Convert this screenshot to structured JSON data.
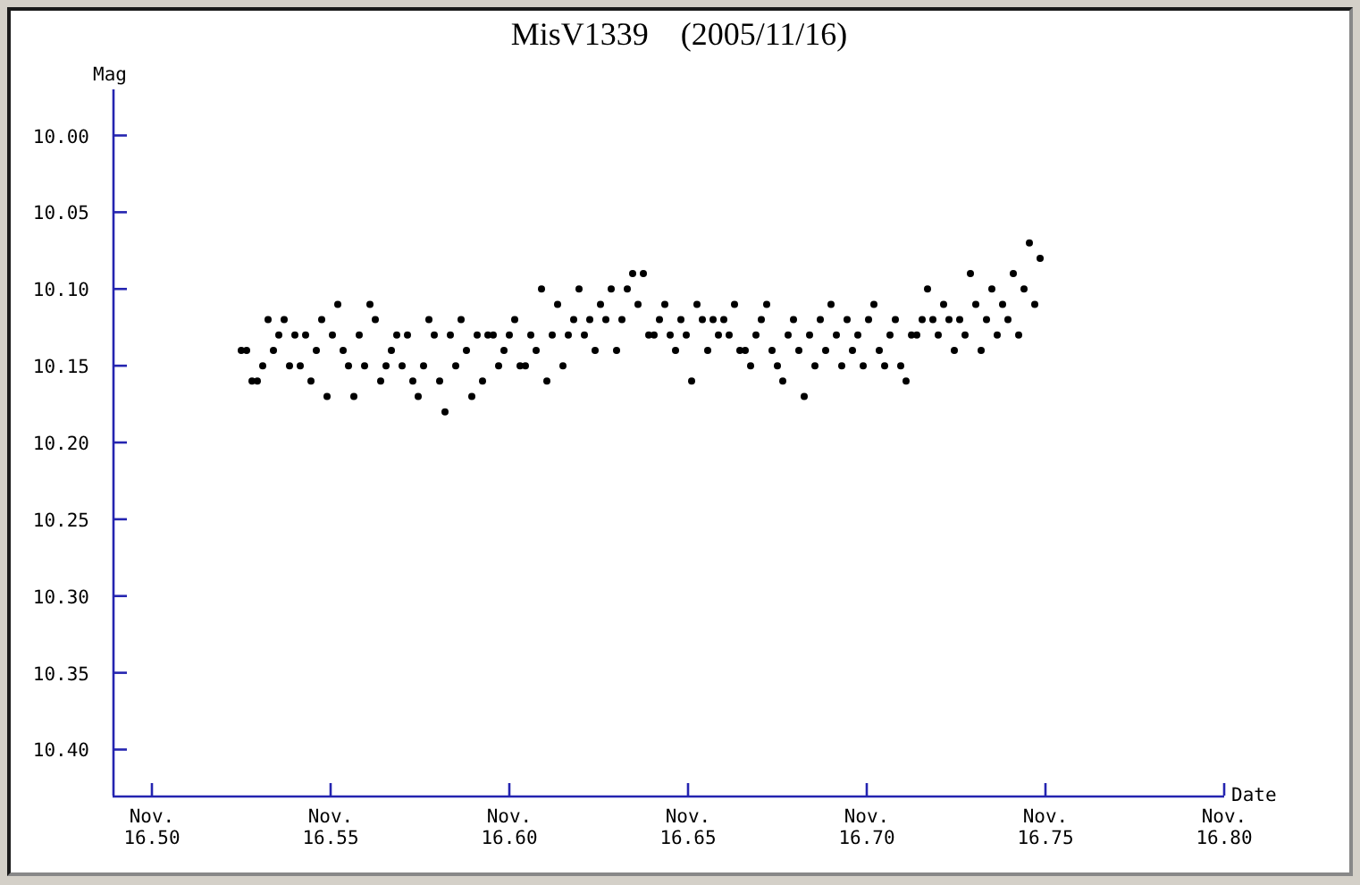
{
  "chart": {
    "chart_data": {
      "type": "scatter",
      "title": "MisV1339　(2005/11/16)",
      "xlabel": "Date",
      "ylabel": "Mag",
      "xlim": [
        16.489,
        16.8
      ],
      "ylim": [
        10.43,
        9.97
      ],
      "xticks": [
        {
          "value": 16.5,
          "label": "16.50"
        },
        {
          "value": 16.55,
          "label": "16.55"
        },
        {
          "value": 16.6,
          "label": "16.60"
        },
        {
          "value": 16.65,
          "label": "16.65"
        },
        {
          "value": 16.7,
          "label": "16.70"
        },
        {
          "value": 16.75,
          "label": "16.75"
        },
        {
          "value": 16.8,
          "label": "16.80"
        }
      ],
      "yticks": [
        {
          "value": 10.0,
          "label": "10.00"
        },
        {
          "value": 10.05,
          "label": "10.05"
        },
        {
          "value": 10.1,
          "label": "10.10"
        },
        {
          "value": 10.15,
          "label": "10.15"
        },
        {
          "value": 10.2,
          "label": "10.20"
        },
        {
          "value": 10.25,
          "label": "10.25"
        },
        {
          "value": 10.3,
          "label": "10.30"
        },
        {
          "value": 10.35,
          "label": "10.35"
        },
        {
          "value": 10.4,
          "label": "10.40"
        }
      ],
      "x": [
        16.525,
        16.5265,
        16.528,
        16.5295,
        16.531,
        16.5325,
        16.534,
        16.5355,
        16.537,
        16.5385,
        16.54,
        16.5415,
        16.543,
        16.5445,
        16.546,
        16.5475,
        16.549,
        16.5505,
        16.552,
        16.5535,
        16.555,
        16.5565,
        16.558,
        16.5595,
        16.561,
        16.5625,
        16.564,
        16.5655,
        16.567,
        16.5685,
        16.57,
        16.5715,
        16.573,
        16.5745,
        16.576,
        16.5775,
        16.579,
        16.5805,
        16.582,
        16.5835,
        16.585,
        16.5865,
        16.588,
        16.5895,
        16.591,
        16.5925,
        16.594,
        16.5955,
        16.597,
        16.5985,
        16.6,
        16.6015,
        16.603,
        16.6045,
        16.606,
        16.6075,
        16.609,
        16.6105,
        16.612,
        16.6135,
        16.615,
        16.6165,
        16.618,
        16.6195,
        16.621,
        16.6225,
        16.624,
        16.6255,
        16.627,
        16.6285,
        16.63,
        16.6315,
        16.633,
        16.6345,
        16.636,
        16.6375,
        16.639,
        16.6405,
        16.642,
        16.6435,
        16.645,
        16.6465,
        16.648,
        16.6495,
        16.651,
        16.6525,
        16.654,
        16.6555,
        16.657,
        16.6585,
        16.66,
        16.6615,
        16.663,
        16.6645,
        16.666,
        16.6675,
        16.669,
        16.6705,
        16.672,
        16.6735,
        16.675,
        16.6765,
        16.678,
        16.6795,
        16.681,
        16.6825,
        16.684,
        16.6855,
        16.687,
        16.6885,
        16.69,
        16.6915,
        16.693,
        16.6945,
        16.696,
        16.6975,
        16.699,
        16.7005,
        16.702,
        16.7035,
        16.705,
        16.7065,
        16.708,
        16.7095,
        16.711,
        16.7125,
        16.714,
        16.7155,
        16.717,
        16.7185,
        16.72,
        16.7215,
        16.723,
        16.7245,
        16.726,
        16.7275,
        16.729,
        16.7305,
        16.732,
        16.7335,
        16.735,
        16.7365,
        16.738,
        16.7395,
        16.741,
        16.7425,
        16.744,
        16.7455,
        16.747,
        16.7485
      ],
      "series": [
        {
          "color": "#000000",
          "values": [
            10.14,
            10.14,
            10.16,
            10.16,
            10.15,
            10.12,
            10.14,
            10.13,
            10.12,
            10.15,
            10.13,
            10.15,
            10.13,
            10.16,
            10.14,
            10.12,
            10.17,
            10.13,
            10.11,
            10.14,
            10.15,
            10.17,
            10.13,
            10.15,
            10.11,
            10.12,
            10.16,
            10.15,
            10.14,
            10.13,
            10.15,
            10.13,
            10.16,
            10.17,
            10.15,
            10.12,
            10.13,
            10.16,
            10.18,
            10.13,
            10.15,
            10.12,
            10.14,
            10.17,
            10.13,
            10.16,
            10.13,
            10.13,
            10.15,
            10.14,
            10.13,
            10.12,
            10.15,
            10.15,
            10.13,
            10.14,
            10.1,
            10.16,
            10.13,
            10.11,
            10.15,
            10.13,
            10.12,
            10.1,
            10.13,
            10.12,
            10.14,
            10.11,
            10.12,
            10.1,
            10.14,
            10.12,
            10.1,
            10.09,
            10.11,
            10.09,
            10.13,
            10.13,
            10.12,
            10.11,
            10.13,
            10.14,
            10.12,
            10.13,
            10.16,
            10.11,
            10.12,
            10.14,
            10.12,
            10.13,
            10.12,
            10.13,
            10.11,
            10.14,
            10.14,
            10.15,
            10.13,
            10.12,
            10.11,
            10.14,
            10.15,
            10.16,
            10.13,
            10.12,
            10.14,
            10.17,
            10.13,
            10.15,
            10.12,
            10.14,
            10.11,
            10.13,
            10.15,
            10.12,
            10.14,
            10.13,
            10.15,
            10.12,
            10.11,
            10.14,
            10.15,
            10.13,
            10.12,
            10.15,
            10.16,
            10.13,
            10.13,
            10.12,
            10.1,
            10.12,
            10.13,
            10.11,
            10.12,
            10.14,
            10.12,
            10.13,
            10.09,
            10.11,
            10.14,
            10.12,
            10.1,
            10.13,
            10.11,
            10.12,
            10.09,
            10.13,
            10.1,
            10.07,
            10.11,
            10.08
          ]
        }
      ]
    },
    "x_tick_months": [
      "Nov.",
      "Nov.",
      "Nov.",
      "Nov.",
      "Nov.",
      "Nov.",
      "Nov."
    ]
  }
}
